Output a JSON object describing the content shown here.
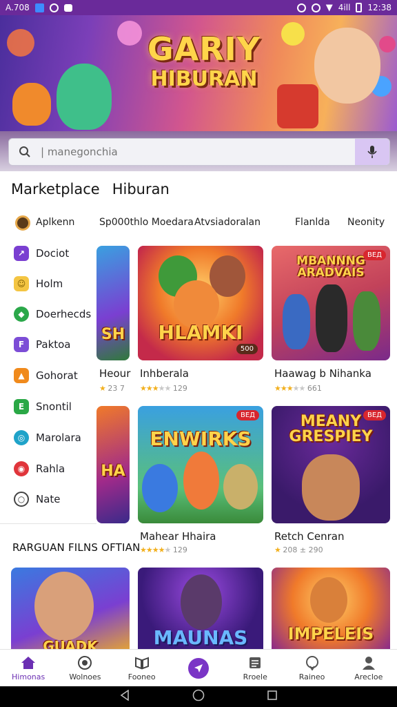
{
  "status_bar": {
    "left_text": "A.708",
    "time": "12:38",
    "signal": "4ill"
  },
  "hero": {
    "title_line1": "GARIY",
    "title_line2": "HIBURAN"
  },
  "search": {
    "placeholder": "| manegonchia"
  },
  "tabs": [
    {
      "label": "Marketplace"
    },
    {
      "label": "Hiburan"
    }
  ],
  "filters": [
    "Aplkenn",
    "Sp000thlo Moedara",
    "Atvsiadoralan",
    "Flanlda",
    "Neonity"
  ],
  "categories": [
    {
      "label": "Dociot",
      "color": "#7a3fd1",
      "glyph": "↗"
    },
    {
      "label": "Holm",
      "color": "#f4c542",
      "glyph": "☺"
    },
    {
      "label": "Doerhecds",
      "color": "#2ba84a",
      "glyph": "◆"
    },
    {
      "label": "Paktoa",
      "color": "#7c4dd6",
      "glyph": "F"
    },
    {
      "label": "Gohorat",
      "color": "#f08a1c",
      "glyph": "▲"
    },
    {
      "label": "Snontil",
      "color": "#2aa846",
      "glyph": "E"
    },
    {
      "label": "Marolara",
      "color": "#1fa3c9",
      "glyph": "◎"
    },
    {
      "label": "Rahla",
      "color": "#e0353b",
      "glyph": "◉"
    },
    {
      "label": "Nate",
      "color": "#444444",
      "glyph": "○"
    }
  ],
  "first_category": {
    "label": "Aplkenn",
    "color": "#5a3a1a"
  },
  "cards_row1": [
    {
      "title": "Heour",
      "rating": "23 7",
      "stars": 2,
      "art": "SH",
      "badge": ""
    },
    {
      "title": "Inhberala",
      "rating": "129",
      "stars": 3,
      "art": "HLAMKI",
      "badge": "500"
    },
    {
      "title": "Haawag b Nihanka",
      "rating": "661",
      "stars": 3,
      "art": "MBANNNG ARADVAIS",
      "badge": "ВЕД"
    }
  ],
  "cards_row2": [
    {
      "title": "",
      "rating": "",
      "stars": 0,
      "art": "HA",
      "badge": ""
    },
    {
      "title": "Mahear Hhaira",
      "rating": "129",
      "stars": 4,
      "art": "ENWIRKS",
      "badge": "ВЕД"
    },
    {
      "title": "Retch Cenran",
      "rating": "208 ± 290",
      "stars": 1,
      "art": "MEANY GRESPIEY",
      "badge": "ВЕД"
    }
  ],
  "section_title": "RARGUAN FILNS OFTIAN",
  "cards_row3": [
    {
      "art": "GUADK"
    },
    {
      "art": "MAUNAS"
    },
    {
      "art": "IMPELEIS"
    }
  ],
  "bottom_nav": [
    {
      "label": "Himonas",
      "icon": "home-icon",
      "active": true
    },
    {
      "label": "Wolnoes",
      "icon": "tv-icon",
      "active": false
    },
    {
      "label": "Fooneo",
      "icon": "book-icon",
      "active": false
    },
    {
      "label": "",
      "icon": "compass-icon",
      "active": false
    },
    {
      "label": "Rroele",
      "icon": "list-icon",
      "active": false
    },
    {
      "label": "Raineo",
      "icon": "heart-icon",
      "active": false
    },
    {
      "label": "Arecloe",
      "icon": "person-icon",
      "active": false
    }
  ]
}
